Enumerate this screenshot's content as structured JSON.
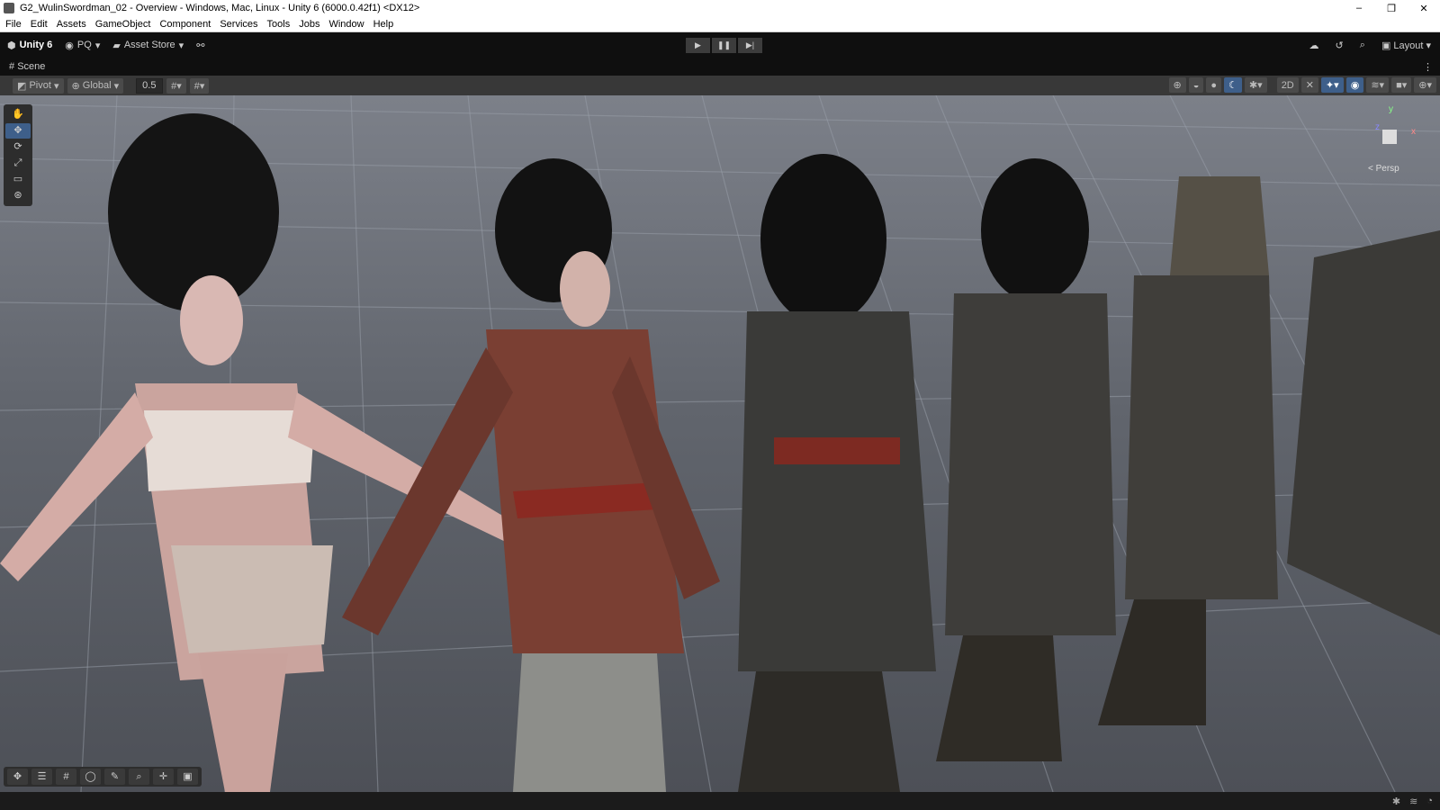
{
  "window": {
    "title": "G2_WulinSwordman_02 - Overview - Windows, Mac, Linux - Unity 6 (6000.0.42f1) <DX12>",
    "controls": [
      "–",
      "❐",
      "✕"
    ]
  },
  "menu": [
    "File",
    "Edit",
    "Assets",
    "GameObject",
    "Component",
    "Services",
    "Tools",
    "Jobs",
    "Window",
    "Help"
  ],
  "toolbar": {
    "unity": "Unity 6",
    "account": "PQ",
    "asset_store": "Asset Store",
    "layout": "Layout"
  },
  "tab": {
    "label": "Scene"
  },
  "scene_toolbar": {
    "pivot": "Pivot",
    "global": "Global",
    "snap_value": "0.5"
  },
  "gizmo": {
    "y": "y",
    "x": "x",
    "z": "z",
    "projection": "< Persp"
  }
}
